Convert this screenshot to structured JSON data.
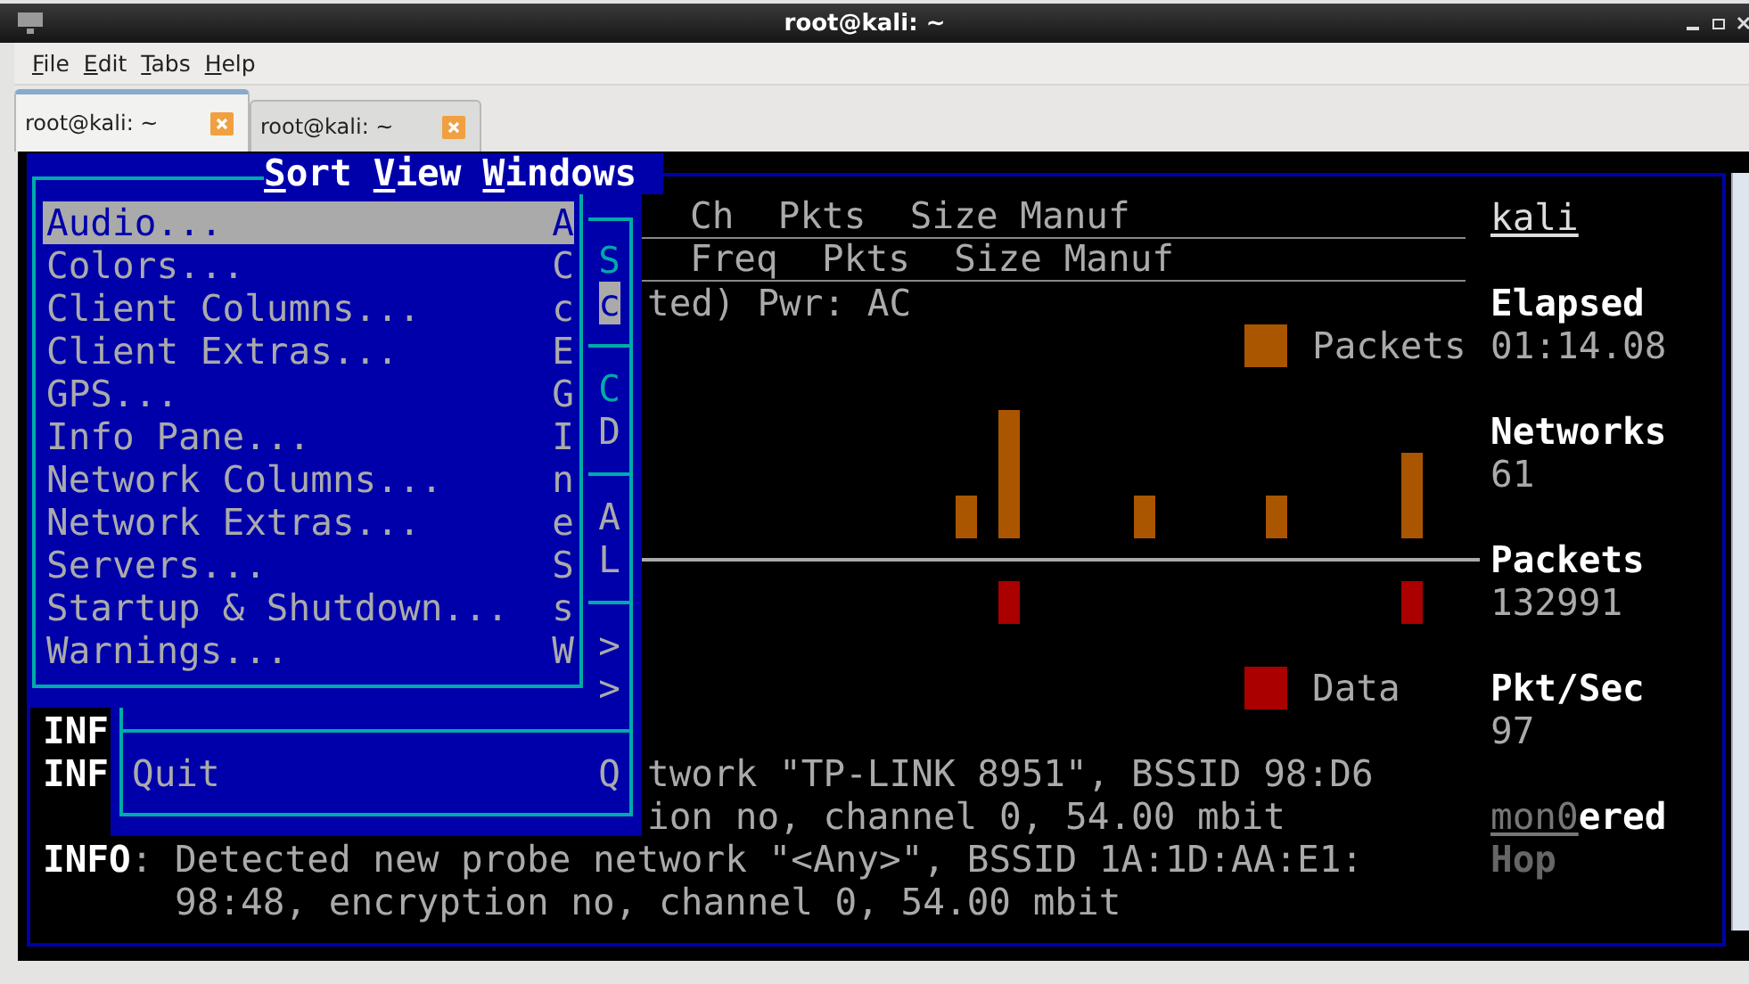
{
  "window": {
    "title": "root@kali: ~"
  },
  "menubar": [
    "File",
    "Edit",
    "Tabs",
    "Help"
  ],
  "tabs": [
    {
      "label": "root@kali: ~",
      "selected": true
    },
    {
      "label": "root@kali: ~",
      "selected": false
    }
  ],
  "terminal": {
    "kismet_menubar": [
      "Sort",
      "View",
      "Windows"
    ],
    "network_header": "Ch  Pkts  Size Manuf",
    "client_header": "Freq  Pkts  Size Manuf",
    "status_line": "ted) Pwr: AC",
    "legend": [
      {
        "label": "Packets",
        "color": "#aa5500"
      },
      {
        "label": "Data",
        "color": "#aa0000"
      }
    ],
    "host": "kali",
    "stats": [
      {
        "label": "Elapsed",
        "value": "01:14.08"
      },
      {
        "label": "Networks",
        "value": "61"
      },
      {
        "label": "Packets",
        "value": "132991"
      },
      {
        "label": "Pkt/Sec",
        "value": "97"
      }
    ],
    "source": {
      "name": "mon0",
      "state": "ered"
    },
    "hop": "Hop",
    "log": [
      {
        "kind": "covered_entry",
        "tag": "INF"
      },
      {
        "kind": "covered_entry",
        "tag": "INF",
        "text": "twork \"TP-LINK 8951\", BSSID 98:D6"
      },
      {
        "kind": "covered_continuation",
        "text": "ion no, channel 0, 54.00 mbit"
      },
      {
        "kind": "entry",
        "tag": "INFO",
        "text": ": Detected new probe network \"<Any>\", BSSID 1A:1D:AA:E1:"
      },
      {
        "kind": "continuation",
        "text": "98:48, encryption no, channel 0, 54.00 mbit"
      }
    ],
    "kismet_menu": {
      "items": [
        {
          "kind": "item",
          "key": "S",
          "color": "#00aaaa",
          "selected": false
        },
        {
          "kind": "item",
          "key": "c",
          "color": "#aaaaaa",
          "selected": true
        },
        {
          "kind": "separator"
        },
        {
          "kind": "item",
          "key": "C",
          "color": "#00aaaa",
          "selected": false
        },
        {
          "kind": "item",
          "key": "D",
          "color": "#aaaaaa",
          "selected": false
        },
        {
          "kind": "separator"
        },
        {
          "kind": "item",
          "key": "A",
          "color": "#aaaaaa",
          "selected": false
        },
        {
          "kind": "item",
          "key": "L",
          "color": "#aaaaaa",
          "selected": false
        },
        {
          "kind": "separator"
        },
        {
          "kind": "item",
          "key": ">",
          "color": "#aaaaaa",
          "selected": false
        },
        {
          "kind": "item",
          "key": ">",
          "color": "#aaaaaa",
          "selected": false
        },
        {
          "kind": "separator"
        },
        {
          "kind": "item",
          "label": "Quit",
          "key": "Q",
          "color": "#aaaaaa",
          "selected": false
        }
      ]
    },
    "preferences_menu": {
      "items": [
        {
          "label": "Audio...",
          "key": "A",
          "selected": true
        },
        {
          "label": "Colors...",
          "key": "C",
          "selected": false
        },
        {
          "label": "Client Columns...",
          "key": "c",
          "selected": false
        },
        {
          "label": "Client Extras...",
          "key": "E",
          "selected": false
        },
        {
          "label": "GPS...",
          "key": "G",
          "selected": false
        },
        {
          "label": "Info Pane...",
          "key": "I",
          "selected": false
        },
        {
          "label": "Network Columns...",
          "key": "n",
          "selected": false
        },
        {
          "label": "Network Extras...",
          "key": "e",
          "selected": false
        },
        {
          "label": "Servers...",
          "key": "S",
          "selected": false
        },
        {
          "label": "Startup & Shutdown...",
          "key": "s",
          "selected": false
        },
        {
          "label": "Warnings...",
          "key": "W",
          "selected": false
        }
      ]
    }
  }
}
